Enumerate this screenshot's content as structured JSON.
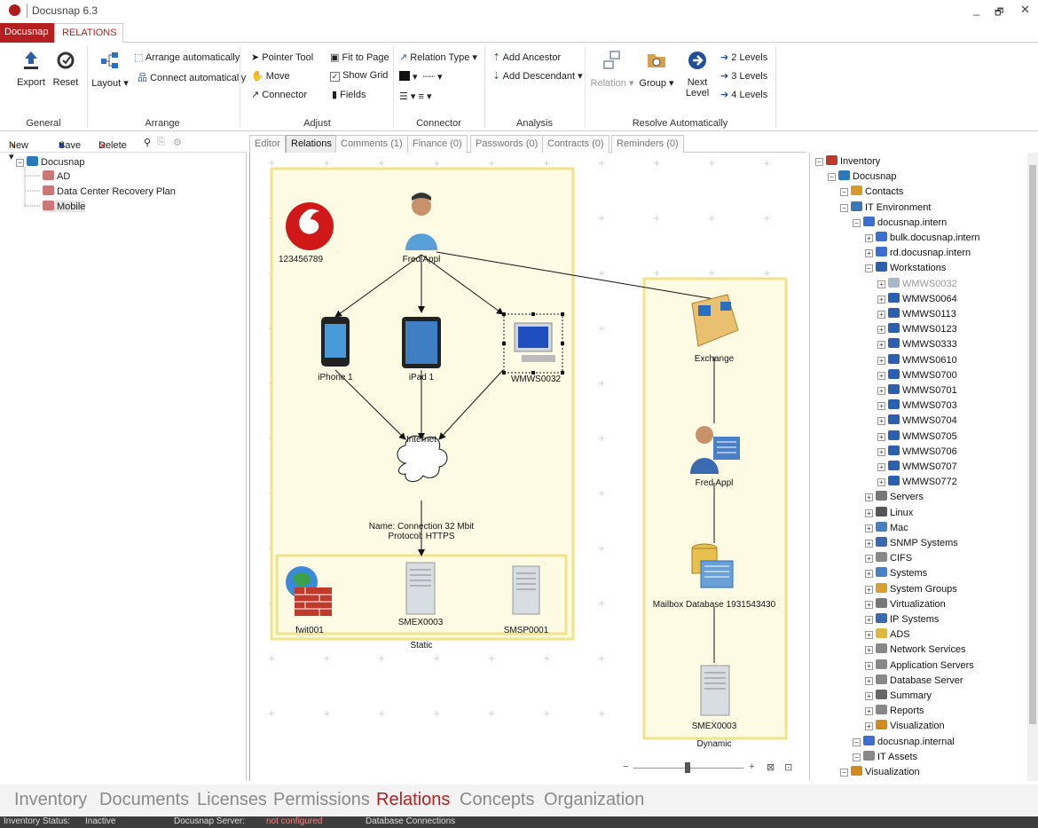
{
  "window": {
    "title": "Docusnap 6.3",
    "minimize": "_",
    "restore": "🗗",
    "close": "✕"
  },
  "ribbon_tabs": {
    "app": "Docusnap",
    "active": "RELATIONS"
  },
  "ribbon": {
    "general": {
      "label": "General",
      "export": "Export",
      "reset": "Reset"
    },
    "arrange": {
      "label": "Arrange",
      "layout": "Layout ▾",
      "arrange_auto": "Arrange automatically",
      "connect_auto": "Connect automatically"
    },
    "adjust": {
      "label": "Adjust",
      "pointer": "Pointer Tool",
      "move": "Move",
      "connector": "Connector",
      "fit": "Fit to Page",
      "grid": "Show Grid",
      "fields": "Fields"
    },
    "connector": {
      "label": "Connector",
      "relation_type": "Relation Type ▾"
    },
    "analysis": {
      "label": "Analysis",
      "add_ancestor": "Add Ancestor",
      "add_descendant": "Add Descendant ▾"
    },
    "resolve": {
      "label": "Resolve Automatically",
      "relation": "Relation ▾",
      "group": "Group ▾",
      "next_level_1": "Next",
      "next_level_2": "Level",
      "lvl2": "2 Levels",
      "lvl3": "3 Levels",
      "lvl4": "4 Levels"
    }
  },
  "left_toolbar": {
    "new": "New ▾",
    "save": "Save",
    "delete": "Delete"
  },
  "left_tree": {
    "root": "Docusnap",
    "items": [
      {
        "label": "AD"
      },
      {
        "label": "Data Center Recovery Plan"
      },
      {
        "label": "Mobile"
      }
    ]
  },
  "doc_tabs": [
    {
      "label": "Editor",
      "active": false
    },
    {
      "label": "Relations",
      "active": true
    },
    {
      "label": "Comments (1)",
      "active": false
    },
    {
      "label": "Finance (0)",
      "active": false
    },
    {
      "label": "Passwords (0)",
      "active": false
    },
    {
      "label": "Contracts (0)",
      "active": false
    },
    {
      "label": "Reminders (0)",
      "active": false
    }
  ],
  "diagram": {
    "nodes": {
      "vodafone": "123456789",
      "fred": "Fred Appl",
      "iphone": "iPhone 1",
      "ipad": "iPad 1",
      "ws": "WMWS0032",
      "internet": "Internet",
      "connection_name": "Name: Connection 32 Mbit",
      "connection_protocol": "Protocol: HTTPS",
      "fwit": "fwit001",
      "smex": "SMEX0003",
      "smsp": "SMSP0001",
      "static": "Static",
      "exchange": "Exchange",
      "fred2": "Fred Appl",
      "mailbox": "Mailbox Database 1931543430",
      "smex2": "SMEX0003",
      "dynamic": "Dynamic"
    }
  },
  "right_tree": [
    {
      "label": "Inventory",
      "level": 0,
      "color": "#c0392b"
    },
    {
      "label": "Docusnap",
      "level": 1,
      "color": "#2a7ab8"
    },
    {
      "label": "Contacts",
      "level": 2,
      "color": "#d89a2a"
    },
    {
      "label": "IT Environment",
      "level": 2,
      "color": "#3a78b5"
    },
    {
      "label": "docusnap.intern",
      "level": 3,
      "color": "#3b6fd0"
    },
    {
      "label": "bulk.docusnap.intern",
      "level": 4,
      "color": "#3b6fd0"
    },
    {
      "label": "rd.docusnap.intern",
      "level": 4,
      "color": "#3b6fd0"
    },
    {
      "label": "Workstations",
      "level": 4,
      "color": "#2b5fb0"
    },
    {
      "label": "WMWS0032",
      "level": 5,
      "color": "#aab8cc",
      "dim": true
    },
    {
      "label": "WMWS0064",
      "level": 5,
      "color": "#2b5fb0"
    },
    {
      "label": "WMWS0113",
      "level": 5,
      "color": "#2b5fb0"
    },
    {
      "label": "WMWS0123",
      "level": 5,
      "color": "#2b5fb0"
    },
    {
      "label": "WMWS0333",
      "level": 5,
      "color": "#2b5fb0"
    },
    {
      "label": "WMWS0610",
      "level": 5,
      "color": "#2b5fb0"
    },
    {
      "label": "WMWS0700",
      "level": 5,
      "color": "#2b5fb0"
    },
    {
      "label": "WMWS0701",
      "level": 5,
      "color": "#2b5fb0"
    },
    {
      "label": "WMWS0703",
      "level": 5,
      "color": "#2b5fb0"
    },
    {
      "label": "WMWS0704",
      "level": 5,
      "color": "#2b5fb0"
    },
    {
      "label": "WMWS0705",
      "level": 5,
      "color": "#2b5fb0"
    },
    {
      "label": "WMWS0706",
      "level": 5,
      "color": "#2b5fb0"
    },
    {
      "label": "WMWS0707",
      "level": 5,
      "color": "#2b5fb0"
    },
    {
      "label": "WMWS0772",
      "level": 5,
      "color": "#2b5fb0"
    },
    {
      "label": "Servers",
      "level": 4,
      "color": "#777777"
    },
    {
      "label": "Linux",
      "level": 4,
      "color": "#555555"
    },
    {
      "label": "Mac",
      "level": 4,
      "color": "#4a7fc0"
    },
    {
      "label": "SNMP Systems",
      "level": 4,
      "color": "#3a6ab0"
    },
    {
      "label": "CIFS",
      "level": 4,
      "color": "#888888"
    },
    {
      "label": "Systems",
      "level": 4,
      "color": "#4a80c8"
    },
    {
      "label": "System Groups",
      "level": 4,
      "color": "#d8a030"
    },
    {
      "label": "Virtualization",
      "level": 4,
      "color": "#777777"
    },
    {
      "label": "IP Systems",
      "level": 4,
      "color": "#3a6ab0"
    },
    {
      "label": "ADS",
      "level": 4,
      "color": "#e0b840"
    },
    {
      "label": "Network Services",
      "level": 4,
      "color": "#888888"
    },
    {
      "label": "Application Servers",
      "level": 4,
      "color": "#888888"
    },
    {
      "label": "Database Server",
      "level": 4,
      "color": "#888888"
    },
    {
      "label": "Summary",
      "level": 4,
      "color": "#666666"
    },
    {
      "label": "Reports",
      "level": 4,
      "color": "#888888"
    },
    {
      "label": "Visualization",
      "level": 4,
      "color": "#d08a20"
    },
    {
      "label": "docusnap.internal",
      "level": 3,
      "color": "#3b6fd0"
    },
    {
      "label": "IT Assets",
      "level": 3,
      "color": "#888888"
    },
    {
      "label": "Visualization",
      "level": 2,
      "color": "#d08a20"
    }
  ],
  "bottom_nav": [
    {
      "label": "Inventory",
      "active": false
    },
    {
      "label": "Documents",
      "active": false
    },
    {
      "label": "Licenses",
      "active": false
    },
    {
      "label": "Permissions",
      "active": false
    },
    {
      "label": "Relations",
      "active": true
    },
    {
      "label": "Concepts",
      "active": false
    },
    {
      "label": "Organization",
      "active": false
    }
  ],
  "status": {
    "inventory": "Inventory Status:",
    "inactive": "Inactive",
    "server": "Docusnap Server:",
    "not_configured": "not configured",
    "db": "Database Connections"
  },
  "colors": {
    "accent": "#b51f1f",
    "group_border": "#f0e38a",
    "group_fill": "#fdfbe4"
  }
}
